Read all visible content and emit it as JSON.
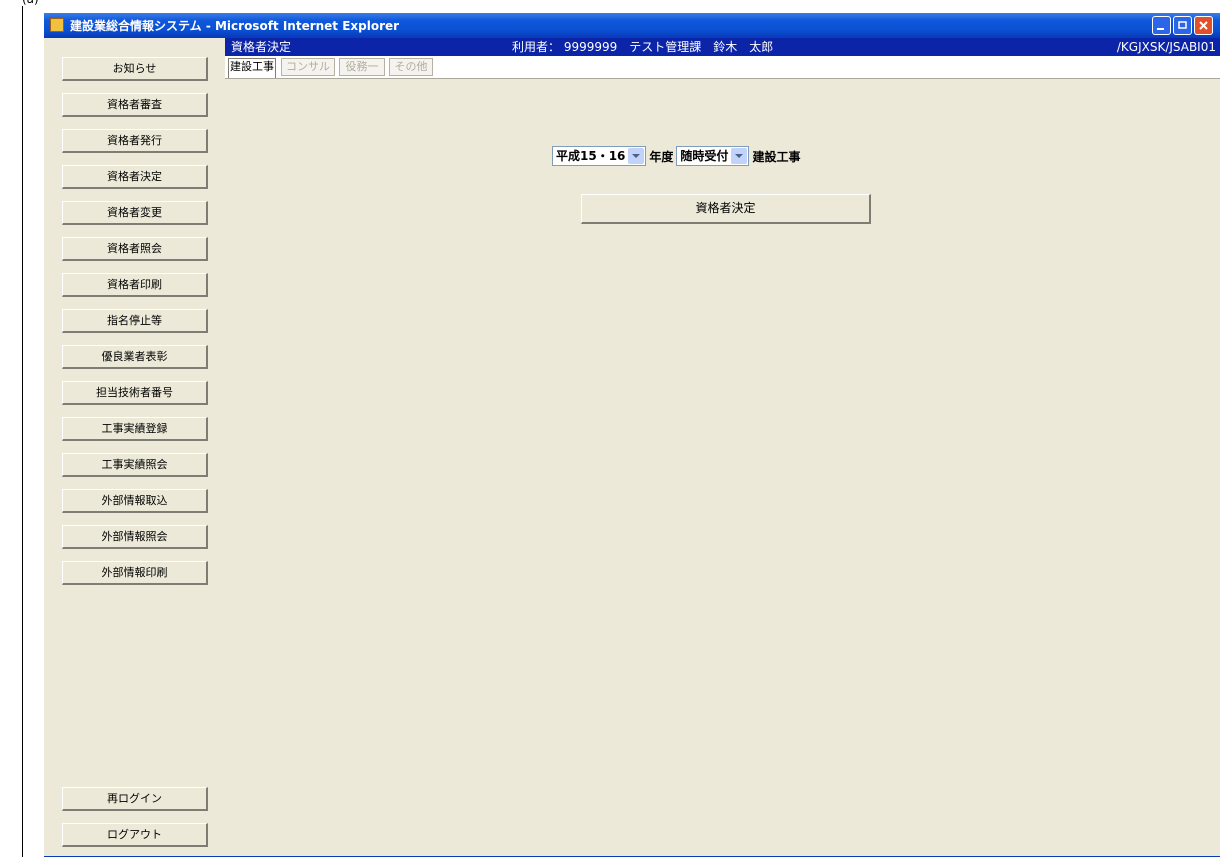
{
  "caption": "(a)",
  "window": {
    "title": "建設業総合情報システム - Microsoft Internet Explorer"
  },
  "sidebar": {
    "items": [
      "お知らせ",
      "資格者審査",
      "資格者発行",
      "資格者決定",
      "資格者変更",
      "資格者照会",
      "資格者印刷",
      "指名停止等",
      "優良業者表彰",
      "担当技術者番号",
      "工事実績登録",
      "工事実績照会",
      "外部情報取込",
      "外部情報照会",
      "外部情報印刷"
    ],
    "relogin": "再ログイン",
    "logout": "ログアウト"
  },
  "header": {
    "page_title": "資格者決定",
    "user_info": "利用者： 9999999　テスト管理課　鈴木　太郎",
    "screen_id": "/KGJXSK/JSABI01"
  },
  "tabs": [
    {
      "label": "建設工事",
      "active": true
    },
    {
      "label": "コンサル",
      "active": false
    },
    {
      "label": "役務一",
      "active": false
    },
    {
      "label": "その他",
      "active": false
    }
  ],
  "filters": {
    "year_value": "平成15・16",
    "year_suffix": "年度",
    "reception_value": "随時受付",
    "category_label": "建設工事"
  },
  "actions": {
    "decide_label": "資格者決定"
  },
  "colors": {
    "title_bar": "#0a4fd1",
    "header_bar": "#0b24a8",
    "panel_bg": "#ece9d8"
  }
}
